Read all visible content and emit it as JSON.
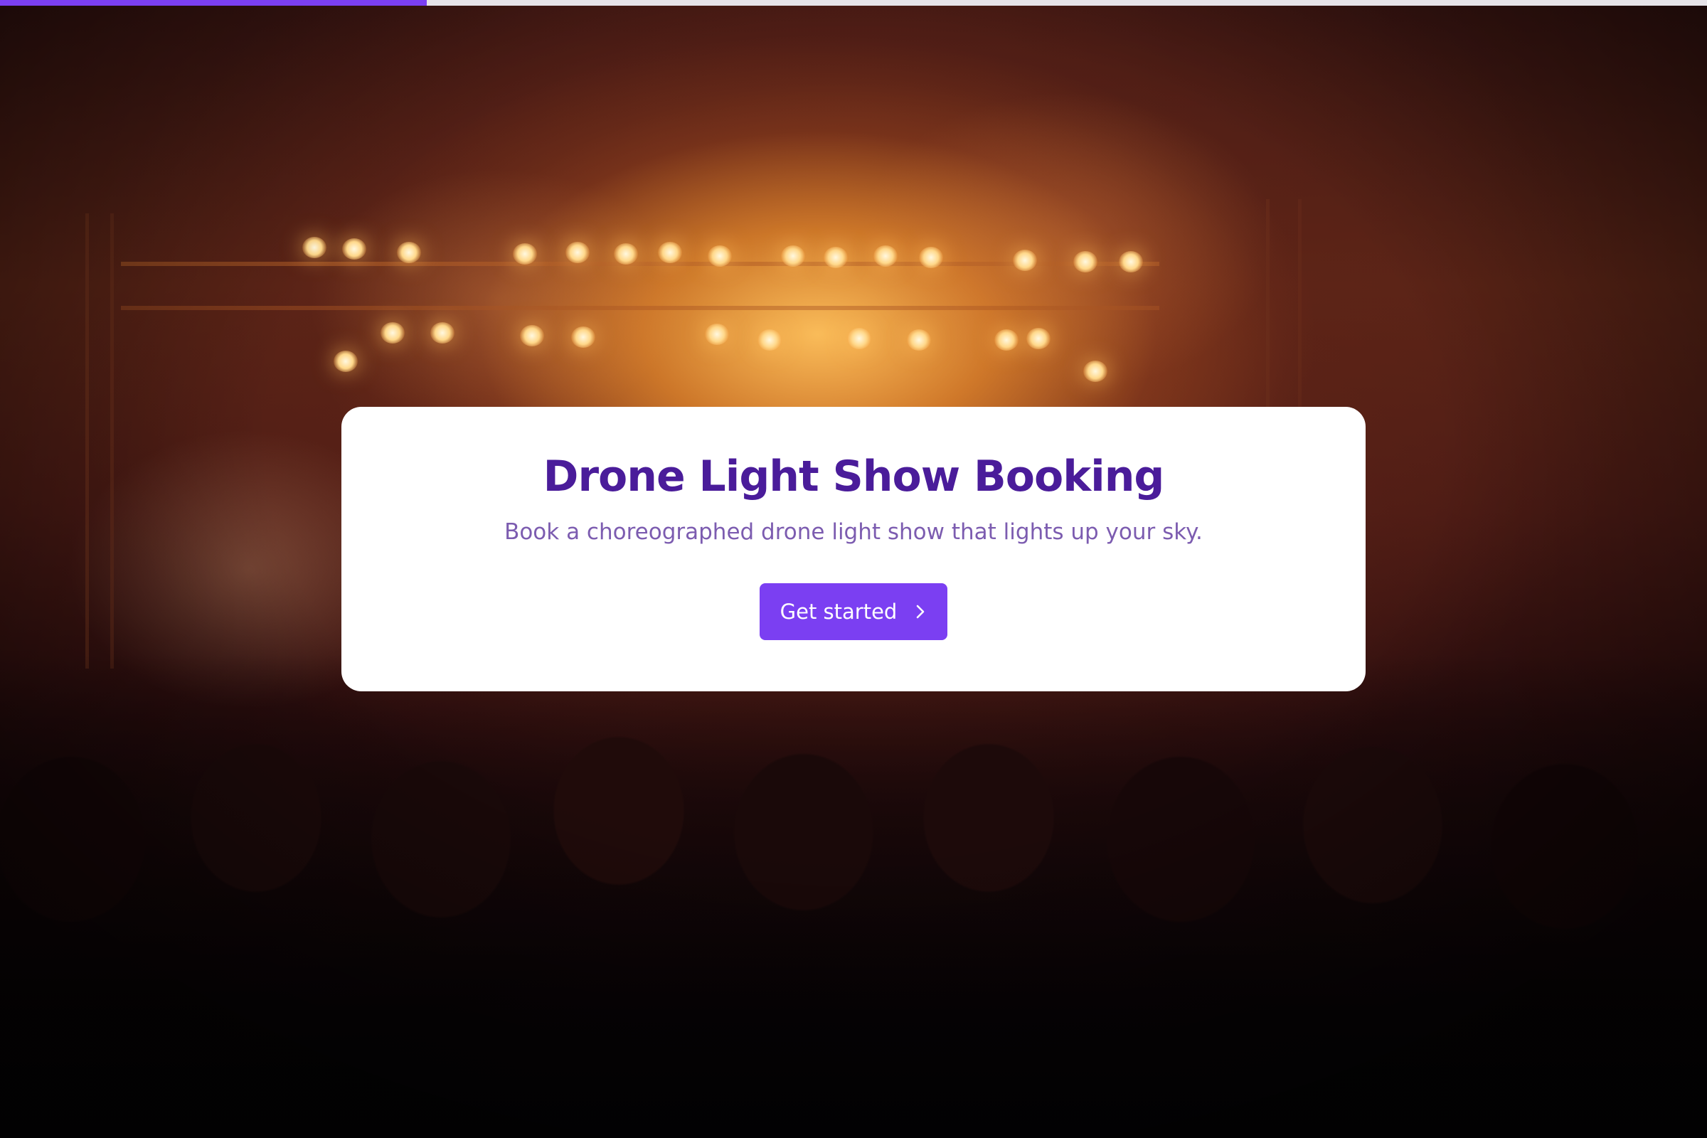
{
  "progress": {
    "fraction": 0.25,
    "fill_color": "#7b3ff2",
    "track_color": "#e6e3e8"
  },
  "background": {
    "description_icon": "concert-crowd-image"
  },
  "card": {
    "title": "Drone Light Show Booking",
    "subtitle": "Book a choreographed drone light show that lights up your sky.",
    "button": {
      "label": "Get started",
      "icon": "chevron-right-icon",
      "color": "#7b3ff2"
    },
    "title_color": "#4a1c9a",
    "subtitle_color": "#7c5cb0"
  }
}
